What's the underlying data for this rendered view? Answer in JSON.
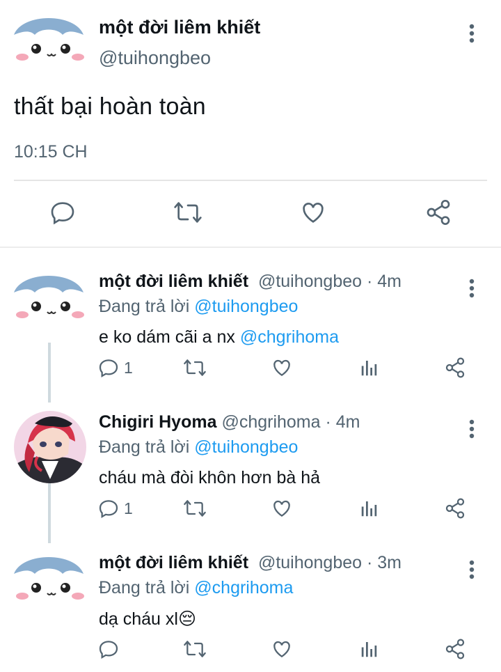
{
  "main_tweet": {
    "name": "một đời liêm khiết",
    "handle": "@tuihongbeo",
    "text": "thất bại hoàn toàn",
    "time": "10:15 CH",
    "actions": [
      "reply-icon",
      "retweet-icon",
      "like-icon",
      "share-icon"
    ]
  },
  "replies": [
    {
      "name": "một đời liêm khiết",
      "handle": "@tuihongbeo",
      "age": "· 4m",
      "replying_label": "Đang trả lời",
      "replying_to": "@tuihongbeo",
      "text": "e ko dám cãi a nx",
      "mention": "@chgrihoma",
      "reply_count": "1",
      "avatar": "kawaii-face"
    },
    {
      "name": "Chigiri Hyoma",
      "handle": "@chgrihoma",
      "age": "· 4m",
      "replying_label": "Đang trả lời",
      "replying_to": "@tuihongbeo",
      "text": "cháu mà đòi khôn hơn bà hả",
      "reply_count": "1",
      "avatar": "anime-character"
    },
    {
      "name": "một đời liêm khiết",
      "handle": "@tuihongbeo",
      "age": "· 3m",
      "replying_label": "Đang trả lời",
      "replying_to": "@chgrihoma",
      "text": "dạ cháu xl",
      "emoji": "😔",
      "reply_count": "",
      "avatar": "kawaii-face"
    }
  ],
  "colors": {
    "link": "#1d9bf0",
    "muted": "#536471",
    "text": "#0f1419"
  }
}
